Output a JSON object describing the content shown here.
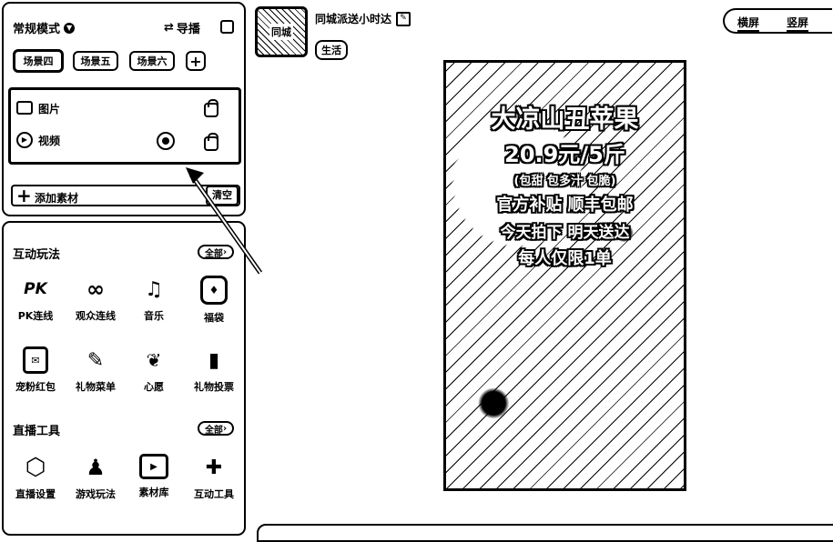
{
  "left_top": {
    "mode_label": "常规模式",
    "director_label": "导播",
    "scenes": [
      "场景四",
      "场景五",
      "场景六"
    ],
    "add_scene_symbol": "+",
    "sources": [
      {
        "label": "图片",
        "icon": "image-icon"
      },
      {
        "label": "视频",
        "icon": "play-circle-icon"
      }
    ],
    "add_material_label": "添加素材",
    "clear_label": "清空"
  },
  "interactive": {
    "title": "互动玩法",
    "more_label": "全部",
    "items": [
      {
        "label": "PK连线",
        "glyph": "PK"
      },
      {
        "label": "观众连线",
        "glyph": "∞"
      },
      {
        "label": "音乐",
        "glyph": "♫"
      },
      {
        "label": "福袋",
        "glyph": "♦"
      },
      {
        "label": "宠粉红包",
        "glyph": "✉"
      },
      {
        "label": "礼物菜单",
        "glyph": "✎"
      },
      {
        "label": "心愿",
        "glyph": "❦"
      },
      {
        "label": "礼物投票",
        "glyph": "▮"
      }
    ]
  },
  "live_tools": {
    "title": "直播工具",
    "more_label": "全部",
    "items": [
      {
        "label": "直播设置",
        "glyph": "⬡"
      },
      {
        "label": "游戏玩法",
        "glyph": "♟"
      },
      {
        "label": "素材库",
        "glyph": "▶"
      },
      {
        "label": "互动工具",
        "glyph": "✚"
      }
    ]
  },
  "header": {
    "avatar_text": "同城",
    "room_title": "同城派送小时达",
    "status_badge": "生活"
  },
  "orientation": {
    "landscape_label": "横屏",
    "portrait_label": "竖屏"
  },
  "preview_text": {
    "line1": "大凉山丑苹果",
    "line2": "20.9元/5斤",
    "line3": "(包甜 包多汁 包脆)",
    "line4": "官方补贴 顺丰包邮",
    "line5": "今天拍下 明天送达",
    "line6": "每人仅限1单"
  }
}
